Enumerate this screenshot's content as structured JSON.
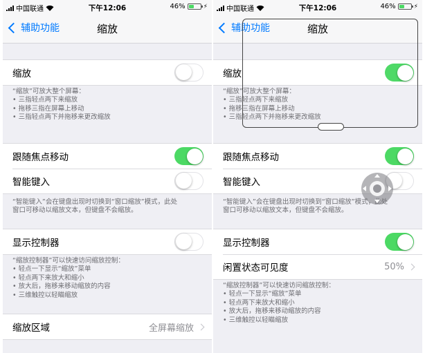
{
  "status": {
    "carrier": "中国联通",
    "time": "下午12:06",
    "battery": "46%",
    "battery_level": 0.46
  },
  "nav": {
    "back": "辅助功能",
    "title": "缩放"
  },
  "left": {
    "zoom": {
      "label": "缩放",
      "on": false
    },
    "zoom_note": [
      "“缩放”可放大整个屏幕：",
      "• 三指轻点两下来缩放",
      "• 拖移三指在屏幕上移动",
      "• 三指轻点两下并拖移来更改缩放"
    ],
    "follow_focus": {
      "label": "跟随焦点移动",
      "on": true
    },
    "smart_typing": {
      "label": "智能键入",
      "on": false
    },
    "typing_note": [
      "“智能键入”会在键盘出现时切换到“窗口缩放”模式，此处",
      "窗口可移动以缩放文本，但键盘不会缩放。"
    ],
    "show_controller": {
      "label": "显示控制器",
      "on": false
    },
    "controller_note": [
      "“缩放控制器”可以快速访问缩放控制：",
      "• 轻点一下显示“缩放”菜单",
      "• 轻点两下来放大和缩小",
      "• 放大后，拖移来移动缩放的内容",
      "• 三维触控以轻瞄缩放"
    ],
    "zoom_region": {
      "label": "缩放区域",
      "value": "全屏幕缩放"
    }
  },
  "right": {
    "zoom": {
      "label": "缩放",
      "on": true
    },
    "zoom_note": [
      "“缩放”可放大整个屏幕：",
      "• 三指轻点两下来缩放",
      "• 拖移三指在屏幕上移动",
      "• 三指轻点两下并拖移来更改缩放"
    ],
    "follow_focus": {
      "label": "跟随焦点移动",
      "on": true
    },
    "smart_typing": {
      "label": "智能键入",
      "on": false
    },
    "typing_note": [
      "“智能键入”会在键盘出现时切换到“窗口缩放”模式，此处",
      "窗口可移动以缩放文本，但键盘不会缩放。"
    ],
    "show_controller": {
      "label": "显示控制器",
      "on": true
    },
    "idle_visibility": {
      "label": "闲置状态可见度",
      "value": "50%"
    },
    "controller_note": [
      "“缩放控制器”可以快速访问缩放控制：",
      "• 轻点一下显示“缩放”菜单",
      "• 轻点两下来放大和缩小",
      "• 放大后，拖移来移动缩放的内容",
      "• 三维触控以轻瞄缩放"
    ]
  },
  "colors": {
    "accent": "#007aff",
    "toggle_on": "#4cd964",
    "background": "#efeff4"
  }
}
